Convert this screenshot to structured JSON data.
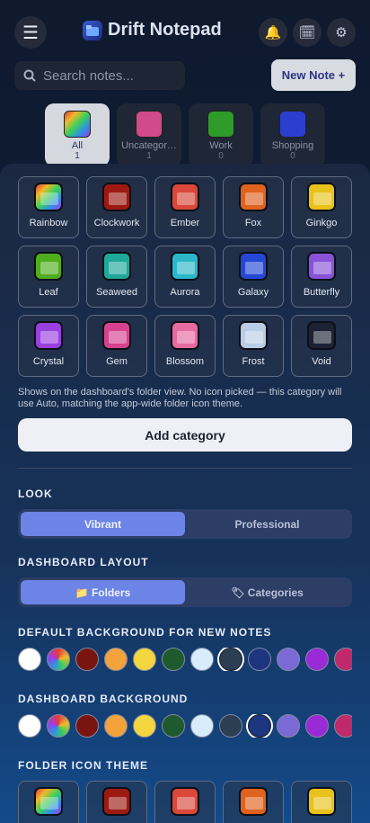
{
  "header": {
    "title": "Drift Notepad",
    "menu_icon": "☰",
    "bell_icon": "🔔",
    "calendar_icon": "🗓",
    "gear_icon": "⚙"
  },
  "search": {
    "placeholder": "Search notes..."
  },
  "new_note_label": "New Note +",
  "categories": [
    {
      "name": "All",
      "count": "1",
      "active": true,
      "color": "rainbow"
    },
    {
      "name": "Uncategorized",
      "display": "Uncategor…",
      "count": "1",
      "color": "#d14a8a"
    },
    {
      "name": "Work",
      "count": "0",
      "color": "#2f9b2a"
    },
    {
      "name": "Shopping",
      "count": "0",
      "color": "#2a3fcf"
    }
  ],
  "folder_icons": [
    {
      "label": "Rainbow",
      "color": "rainbow"
    },
    {
      "label": "Clockwork",
      "color": "#9c1a12"
    },
    {
      "label": "Ember",
      "color": "#d9483a"
    },
    {
      "label": "Fox",
      "color": "#e0621f"
    },
    {
      "label": "Ginkgo",
      "color": "#e8c21a"
    },
    {
      "label": "Leaf",
      "color": "#4fae1c"
    },
    {
      "label": "Seaweed",
      "color": "#1fa898"
    },
    {
      "label": "Aurora",
      "color": "#2bb7c9"
    },
    {
      "label": "Galaxy",
      "color": "#2447d6"
    },
    {
      "label": "Butterfly",
      "color": "#8a52d8"
    },
    {
      "label": "Crystal",
      "color": "#9a3fe0"
    },
    {
      "label": "Gem",
      "color": "#d6428f"
    },
    {
      "label": "Blossom",
      "color": "#e76aa0"
    },
    {
      "label": "Frost",
      "color": "#b9cee6"
    },
    {
      "label": "Void",
      "color": "#1c2233"
    }
  ],
  "help_text": "Shows on the dashboard's folder view. No icon picked — this category will use Auto, matching the app-wide folder icon theme.",
  "add_category_label": "Add category",
  "look": {
    "title": "LOOK",
    "options": [
      "Vibrant",
      "Professional"
    ],
    "selected": "Vibrant"
  },
  "dashboard_layout": {
    "title": "DASHBOARD LAYOUT",
    "options": [
      "📁 Folders",
      "🏷 Categories"
    ],
    "selected": "📁 Folders"
  },
  "default_bg": {
    "title": "DEFAULT BACKGROUND FOR NEW NOTES",
    "selected_index": 7
  },
  "dashboard_bg": {
    "title": "DASHBOARD BACKGROUND",
    "selected_index": 8
  },
  "folder_icon_theme": {
    "title": "FOLDER ICON THEME"
  },
  "swatch_colors": [
    "#ffffff",
    "rainbow",
    "#7a1410",
    "#f4a23c",
    "#f3d640",
    "#1e5a2e",
    "#d8ecfb",
    "#2c3e52",
    "#1e3680",
    "#7b6ad6",
    "#9a2ad6",
    "#c02a6a"
  ]
}
